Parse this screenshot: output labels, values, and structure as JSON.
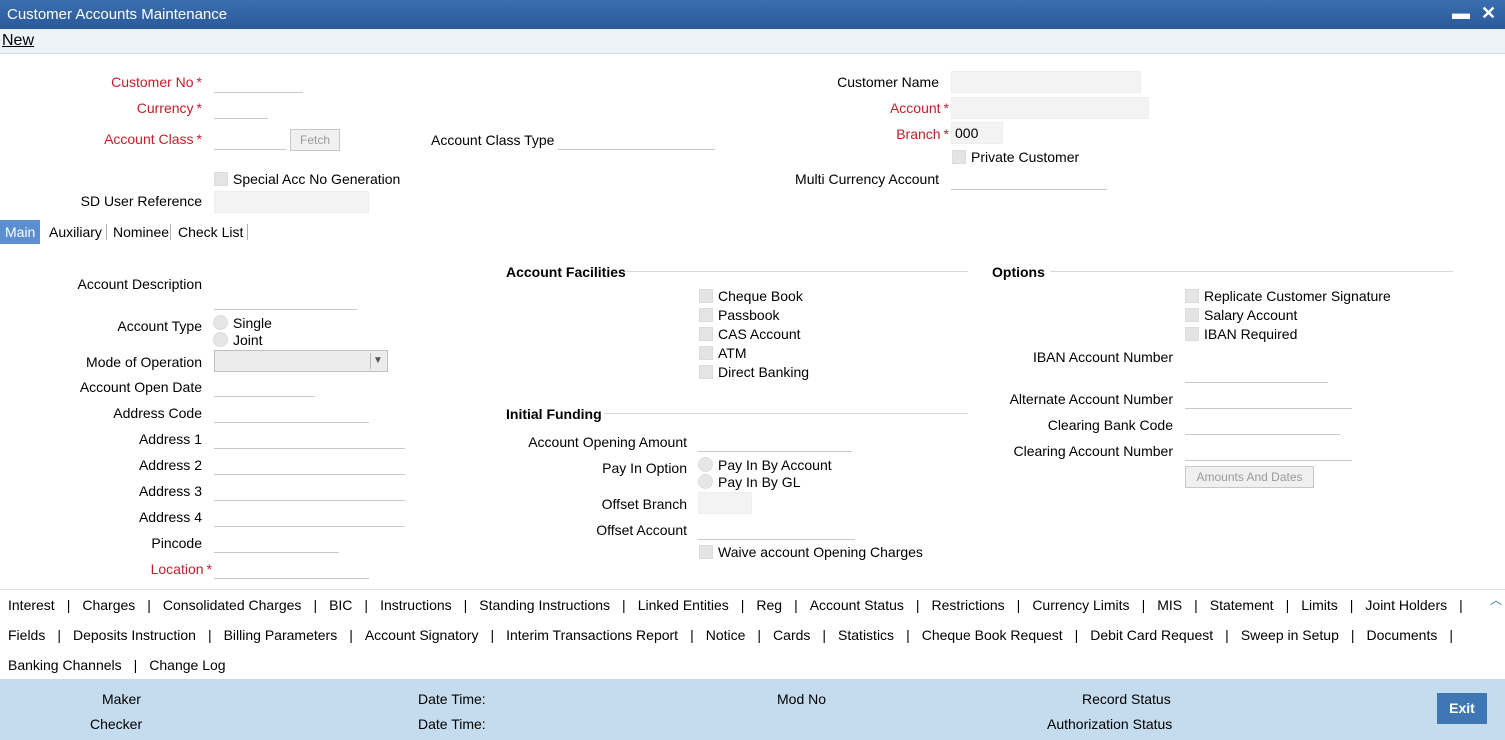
{
  "window": {
    "title": "Customer Accounts Maintenance",
    "minimize_glyph": "▬",
    "close_glyph": "✕"
  },
  "menu": {
    "new_label": "New"
  },
  "header": {
    "customer_no": {
      "label": "Customer No",
      "value": ""
    },
    "currency": {
      "label": "Currency",
      "value": ""
    },
    "account_class": {
      "label": "Account Class",
      "value": ""
    },
    "fetch_button": "Fetch",
    "account_class_type": {
      "label": "Account Class Type",
      "value": ""
    },
    "special_acc_no": "Special Acc No Generation",
    "sd_user_reference": {
      "label": "SD User Reference",
      "value": ""
    },
    "customer_name": {
      "label": "Customer Name",
      "value": ""
    },
    "account": {
      "label": "Account",
      "value": ""
    },
    "branch": {
      "label": "Branch",
      "value": "000"
    },
    "private_customer": "Private Customer",
    "multi_currency": {
      "label": "Multi Currency Account",
      "value": ""
    },
    "required_mark": "*"
  },
  "tabs": [
    {
      "label": "Main",
      "active": true
    },
    {
      "label": "Auxiliary",
      "active": false
    },
    {
      "label": "Nominee",
      "active": false
    },
    {
      "label": "Check List",
      "active": false
    }
  ],
  "main": {
    "account_description": "Account Description",
    "account_type": "Account Type",
    "single": "Single",
    "joint": "Joint",
    "mode_of_operation": "Mode of Operation",
    "account_open_date": "Account Open Date",
    "address_code": "Address Code",
    "address1": "Address 1",
    "address2": "Address 2",
    "address3": "Address 3",
    "address4": "Address 4",
    "pincode": "Pincode",
    "location": "Location"
  },
  "facilities": {
    "heading": "Account Facilities",
    "items": [
      "Cheque Book",
      "Passbook",
      "CAS Account",
      "ATM",
      "Direct Banking"
    ]
  },
  "funding": {
    "heading": "Initial Funding",
    "opening_amount": "Account Opening Amount",
    "pay_in_option": "Pay In Option",
    "pay_by_account": "Pay In By Account",
    "pay_by_gl": "Pay In By GL",
    "offset_branch": "Offset Branch",
    "offset_account": "Offset Account",
    "waive": "Waive account Opening Charges"
  },
  "options": {
    "heading": "Options",
    "items": [
      "Replicate Customer Signature",
      "Salary Account",
      "IBAN Required"
    ],
    "iban_account_number": "IBAN Account Number",
    "alternate_account_number": "Alternate Account Number",
    "clearing_bank_code": "Clearing Bank Code",
    "clearing_account_number": "Clearing Account Number",
    "amounts_button": "Amounts And Dates"
  },
  "links": {
    "row1": [
      "Interest",
      "Charges",
      "Consolidated Charges",
      "BIC",
      "Instructions",
      "Standing Instructions",
      "Linked Entities",
      "Reg",
      "Account Status",
      "Restrictions",
      "Currency Limits",
      "MIS",
      "Statement",
      "Limits",
      "Joint Holders"
    ],
    "row2": [
      "Fields",
      "Deposits Instruction",
      "Billing Parameters",
      "Account Signatory",
      "Interim Transactions Report",
      "Notice",
      "Cards",
      "Statistics",
      "Cheque Book Request",
      "Debit Card Request",
      "Sweep in Setup",
      "Documents"
    ],
    "row3": [
      "Banking Channels",
      "Change Log"
    ],
    "separator": "|"
  },
  "footer": {
    "maker": "Maker",
    "checker": "Checker",
    "date_time": "Date Time:",
    "mod_no": "Mod No",
    "record_status": "Record Status",
    "authorization_status": "Authorization Status",
    "exit": "Exit"
  },
  "colors": {
    "title_bar": "#2f63a5",
    "active_tab": "#5b8fd0",
    "footer": "#c5dbee",
    "required": "#c41e2b",
    "exit_button": "#3f77b5"
  }
}
